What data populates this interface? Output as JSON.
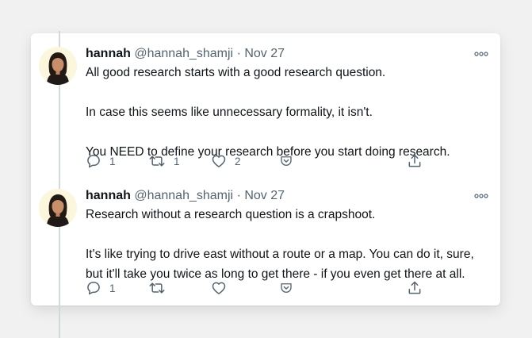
{
  "tweets": [
    {
      "name": "hannah",
      "handle": "@hannah_shamji",
      "separator": "·",
      "date": "Nov 27",
      "lines": [
        "All good research starts with a good research question.",
        "",
        "In case this seems like unnecessary formality, it isn't.",
        "",
        "You NEED to define your research before you start doing research."
      ],
      "reply_count": "1",
      "retweet_count": "1",
      "like_count": "2"
    },
    {
      "name": "hannah",
      "handle": "@hannah_shamji",
      "separator": "·",
      "date": "Nov 27",
      "lines": [
        "Research without a research question is a crapshoot.",
        "",
        "It's like trying to drive east without a route or a map. You can do it, sure,",
        "but it'll take you twice as long to get there - if you even get there at all."
      ],
      "reply_count": "1",
      "retweet_count": "",
      "like_count": ""
    }
  ],
  "icons": {
    "reply": "reply-icon",
    "retweet": "retweet-icon",
    "like": "heart-icon",
    "save": "pocket-icon",
    "share": "share-icon",
    "more": "more-icon"
  },
  "colors": {
    "text": "#0f1419",
    "secondary": "#536471",
    "thread_line": "#cfd9de"
  }
}
